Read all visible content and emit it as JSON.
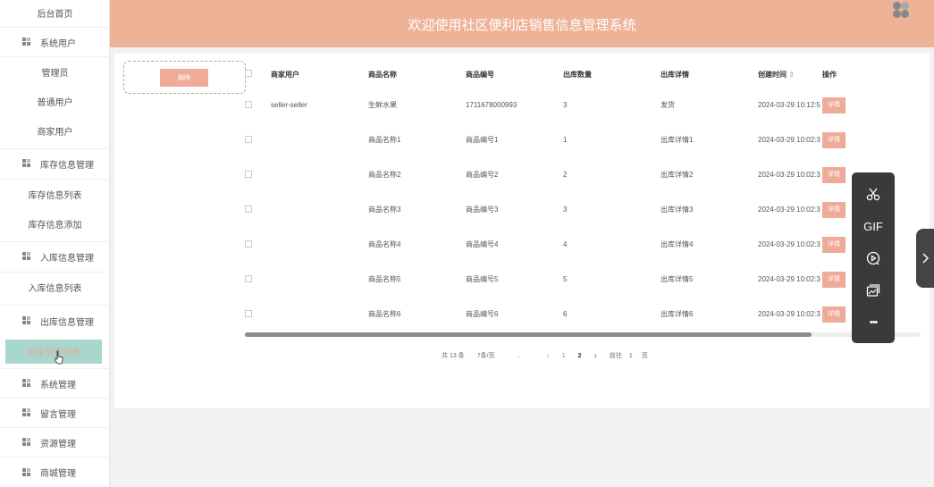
{
  "sidebar": {
    "items": [
      {
        "label": "后台首页"
      },
      {
        "label": "系统用户"
      },
      {
        "label": "管理员"
      },
      {
        "label": "普通用户"
      },
      {
        "label": "商家用户"
      },
      {
        "label": "库存信息管理"
      },
      {
        "label": "库存信息列表"
      },
      {
        "label": "库存信息添加"
      },
      {
        "label": "入库信息管理"
      },
      {
        "label": "入库信息列表"
      },
      {
        "label": "出库信息管理"
      },
      {
        "label": "出库信息列表"
      },
      {
        "label": "系统管理"
      },
      {
        "label": "留言管理"
      },
      {
        "label": "资源管理"
      },
      {
        "label": "商城管理"
      }
    ]
  },
  "header": {
    "title": "欢迎使用社区便利店销售信息管理系统"
  },
  "toolbar_main": {
    "delete_label": "删除"
  },
  "table": {
    "columns": [
      "商家用户",
      "商品名称",
      "商品编号",
      "出库数量",
      "出库详情",
      "创建时间",
      "操作"
    ],
    "sort_indicator": "⇕",
    "rows": [
      {
        "user": "seller-seller",
        "name": "生鲜水果",
        "code": "1711678000993",
        "qty": "3",
        "detail": "发货",
        "time": "2024-03-29 10:12:5",
        "op": "详情"
      },
      {
        "user": "",
        "name": "商品名称1",
        "code": "商品编号1",
        "qty": "1",
        "detail": "出库详情1",
        "time": "2024-03-29 10:02:3",
        "op": "详情"
      },
      {
        "user": "",
        "name": "商品名称2",
        "code": "商品编号2",
        "qty": "2",
        "detail": "出库详情2",
        "time": "2024-03-29 10:02:3",
        "op": "详情"
      },
      {
        "user": "",
        "name": "商品名称3",
        "code": "商品编号3",
        "qty": "3",
        "detail": "出库详情3",
        "time": "2024-03-29 10:02:3",
        "op": "详情"
      },
      {
        "user": "",
        "name": "商品名称4",
        "code": "商品编号4",
        "qty": "4",
        "detail": "出库详情4",
        "time": "2024-03-29 10:02:3",
        "op": "详情"
      },
      {
        "user": "",
        "name": "商品名称5",
        "code": "商品编号5",
        "qty": "5",
        "detail": "出库详情5",
        "time": "2024-03-29 10:02:3",
        "op": "详情"
      },
      {
        "user": "",
        "name": "商品名称6",
        "code": "商品编号6",
        "qty": "6",
        "detail": "出库详情6",
        "time": "2024-03-29 10:02:3",
        "op": "详情"
      }
    ]
  },
  "pagination": {
    "total": "共 13 条",
    "page_size": "7条/页",
    "page_size_arrow": "⌄",
    "prev": "‹",
    "page1": "1",
    "page2": "2",
    "next": "›",
    "goto_label": "前往",
    "goto_value": "1",
    "goto_suffix": "页"
  },
  "floating_toolbar": {
    "gif_label": "GIF",
    "more_label": "•••"
  },
  "colors": {
    "header": "#eeb297",
    "accent_button": "#eeac98",
    "active_sidebar": "#a9d6cd"
  }
}
